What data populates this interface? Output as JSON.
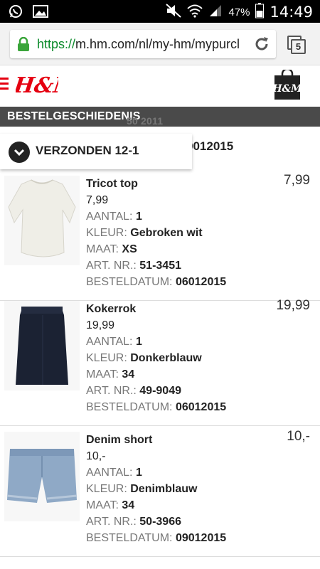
{
  "status_bar": {
    "battery": "47%",
    "time": "14:49",
    "icons": [
      "whatsapp-icon",
      "gallery-icon",
      "mute-icon",
      "wifi-icon",
      "signal-icon",
      "battery-icon"
    ]
  },
  "browser": {
    "url_scheme": "https://",
    "url_rest": "m.hm.com/nl/my-hm/mypurcl",
    "tab_count": "5"
  },
  "header": {
    "logo_text": "H&M",
    "bag_text": "H&M"
  },
  "section": {
    "title": "BESTELGESCHIEDENIS",
    "ghost_text": "50 2011"
  },
  "order": {
    "number_partial": "0012015",
    "dropdown_label": "VERZONDEN 12-1"
  },
  "labels": {
    "qty": "AANTAL:",
    "color": "KLEUR:",
    "size": "MAAT:",
    "art": "ART. NR.:",
    "date": "BESTELDATUM:"
  },
  "items": [
    {
      "name": "Tricot top",
      "unit_price": "7,99",
      "qty": "1",
      "color": "Gebroken wit",
      "size": "XS",
      "art": "51-3451",
      "date": "06012015",
      "total": "7,99"
    },
    {
      "name": "Kokerrok",
      "unit_price": "19,99",
      "qty": "1",
      "color": "Donkerblauw",
      "size": "34",
      "art": "49-9049",
      "date": "06012015",
      "total": "19,99"
    },
    {
      "name": "Denim short",
      "unit_price": "10,-",
      "qty": "1",
      "color": "Denimblauw",
      "size": "34",
      "art": "50-3966",
      "date": "09012015",
      "total": "10,-"
    }
  ],
  "colors": {
    "hm_red": "#e50010",
    "url_green": "#0a8a2a",
    "section_bg": "#4a4a4a"
  }
}
